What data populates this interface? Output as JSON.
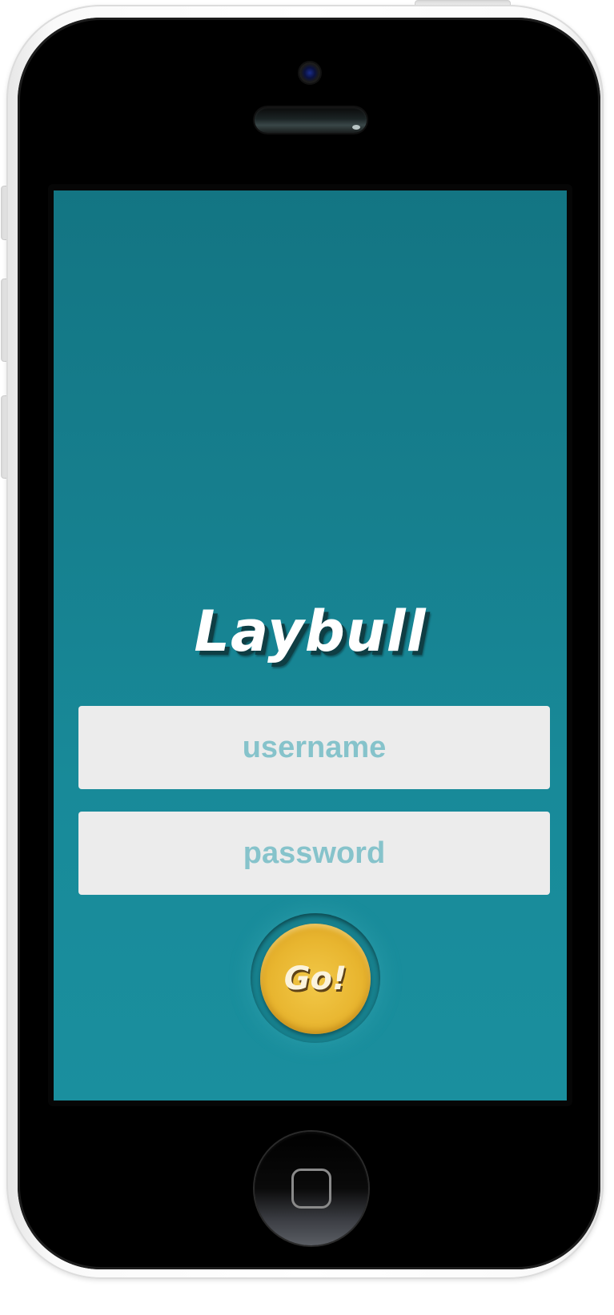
{
  "app": {
    "title": "Laybull"
  },
  "login": {
    "username_placeholder": "username",
    "password_placeholder": "password",
    "go_label": "Go!"
  },
  "theme": {
    "background": "#1a8a98",
    "title_color": "#ffffff",
    "field_background": "#ececec",
    "placeholder_color": "#86c3cb",
    "button_color": "#e8b52f"
  },
  "icons": {
    "home": "home-square-icon"
  }
}
